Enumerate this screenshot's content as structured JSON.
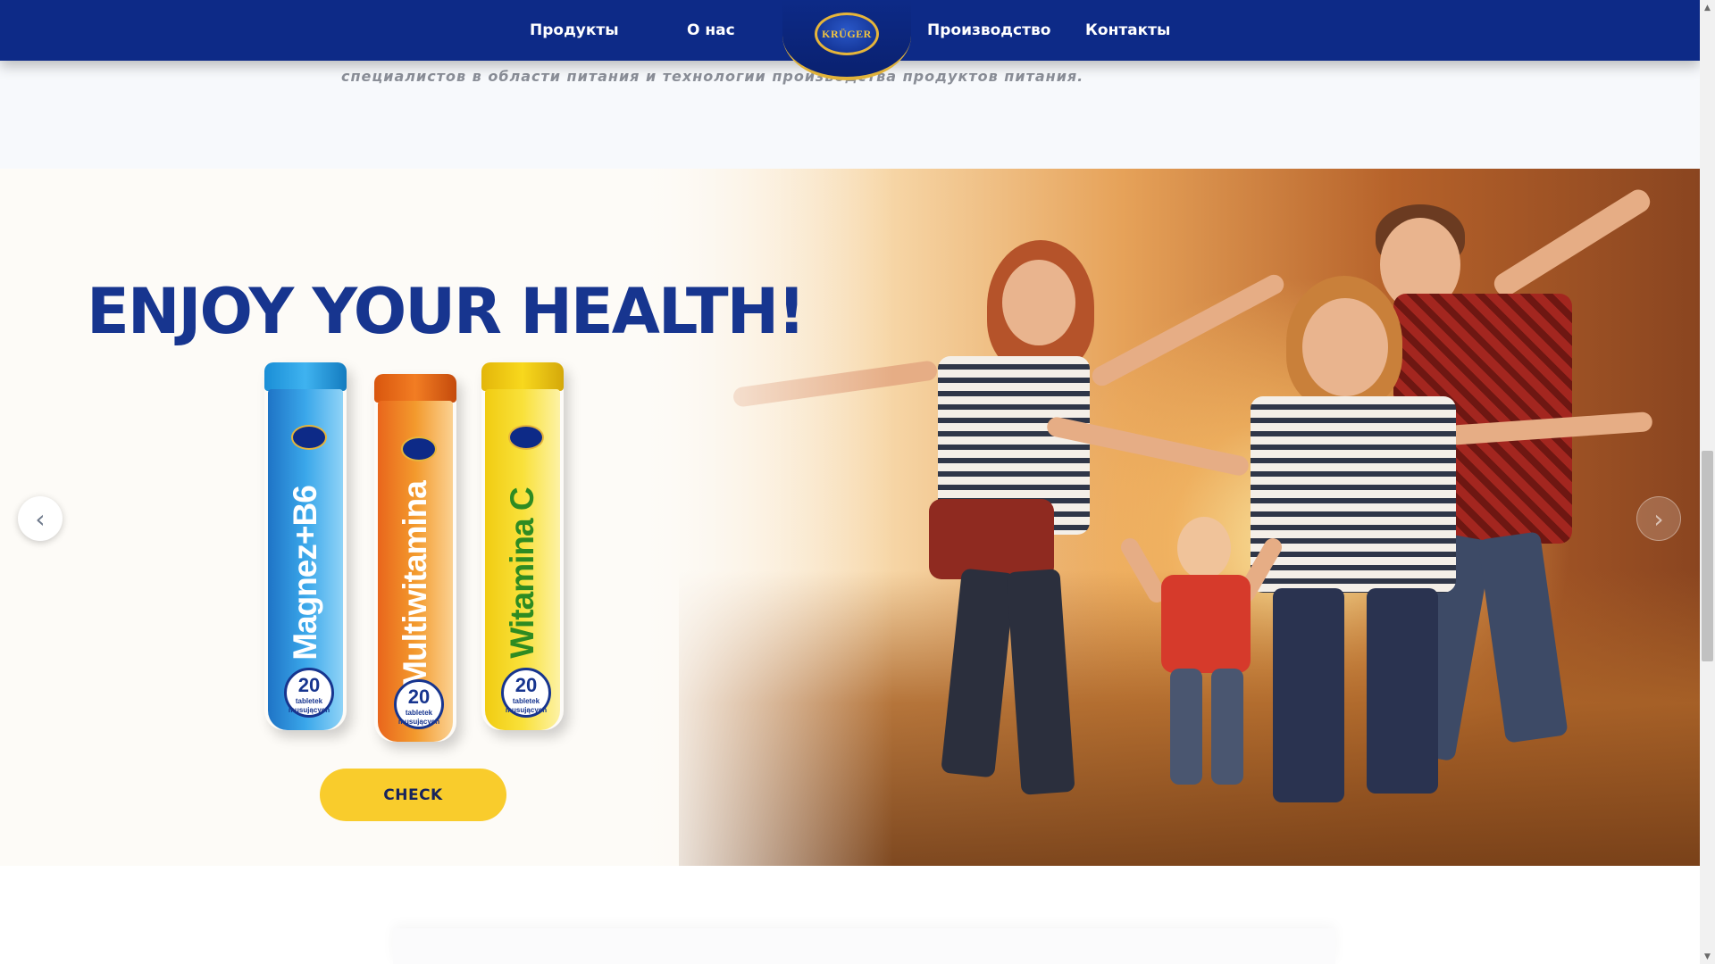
{
  "nav": {
    "items": [
      {
        "label": "Продукты"
      },
      {
        "label": "О нас"
      },
      {
        "label": "Производство"
      },
      {
        "label": "Контакты"
      }
    ],
    "logo_text": "KRÜGER"
  },
  "intro": {
    "text": "специалистов в области питания и технологии производства продуктов питания."
  },
  "hero": {
    "title": "ENJOY YOUR HEALTH!",
    "products": [
      {
        "name": "Magnez+B6",
        "count": "20",
        "count_sub": "tabletek musujących",
        "color": "#2a9be0"
      },
      {
        "name": "Multiwitamina",
        "count": "20",
        "count_sub": "tabletek musujących",
        "color": "#f07a22"
      },
      {
        "name": "Witamina C",
        "count": "20",
        "count_sub": "tabletek musujących",
        "color": "#f5d21c"
      }
    ],
    "cta_label": "CHECK",
    "prev_arrow": "‹",
    "next_arrow": "›"
  },
  "colors": {
    "nav_bg": "#0d2a87",
    "title": "#17358f",
    "cta_bg": "#f9cc2c"
  },
  "scrollbar": {
    "up_arrow": "▲",
    "down_arrow": "▼"
  }
}
